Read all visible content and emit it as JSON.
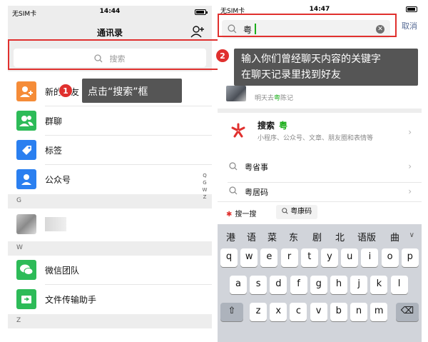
{
  "left": {
    "status": {
      "carrier": "无SIM卡",
      "time": "14:44"
    },
    "nav_title": "通讯录",
    "search_placeholder": "搜索",
    "rows": [
      {
        "label": "新的朋友",
        "color": "#f58c38"
      },
      {
        "label": "群聊",
        "color": "#2dbb58"
      },
      {
        "label": "标签",
        "color": "#2a7ff0"
      },
      {
        "label": "公众号",
        "color": "#2a7ff0"
      }
    ],
    "section_g": "G",
    "section_w": "W",
    "section_z": "Z",
    "rows_w": [
      {
        "label": "微信团队",
        "color": "#2dbb58"
      },
      {
        "label": "文件传输助手",
        "color": "#2dbb58"
      }
    ],
    "index_letters": [
      "Q",
      "G",
      "W",
      "Z"
    ],
    "tip": "点击“搜索”框",
    "badge": "1"
  },
  "right": {
    "status": {
      "carrier": "无SIM卡",
      "time": "14:47"
    },
    "query": "粤",
    "cancel": "取消",
    "tip_line1": "输入你们曾经聊天内容的关键字",
    "tip_line2": "在聊天记录里找到好友",
    "badge": "2",
    "chat_snippet_pre": "明天去",
    "chat_snippet_hl": "粤",
    "chat_snippet_post": "陈记",
    "sousuo_title": "搜索",
    "sousuo_hl": "粤",
    "sousuo_sub": "小程序、公众号、文章、朋友圈和表情等",
    "suggestions": [
      "粤省事",
      "粤居码"
    ],
    "quick_sousuo": "搜一搜",
    "quick_chip": "粤康码",
    "candidates": [
      "港",
      "语",
      "菜",
      "东",
      "剧",
      "北",
      "语版",
      "曲"
    ],
    "keys_row1": [
      "q",
      "w",
      "e",
      "r",
      "t",
      "y",
      "u",
      "i",
      "o",
      "p"
    ],
    "keys_row2": [
      "a",
      "s",
      "d",
      "f",
      "g",
      "h",
      "j",
      "k",
      "l"
    ],
    "keys_row3": [
      "z",
      "x",
      "c",
      "v",
      "b",
      "n",
      "m"
    ]
  }
}
